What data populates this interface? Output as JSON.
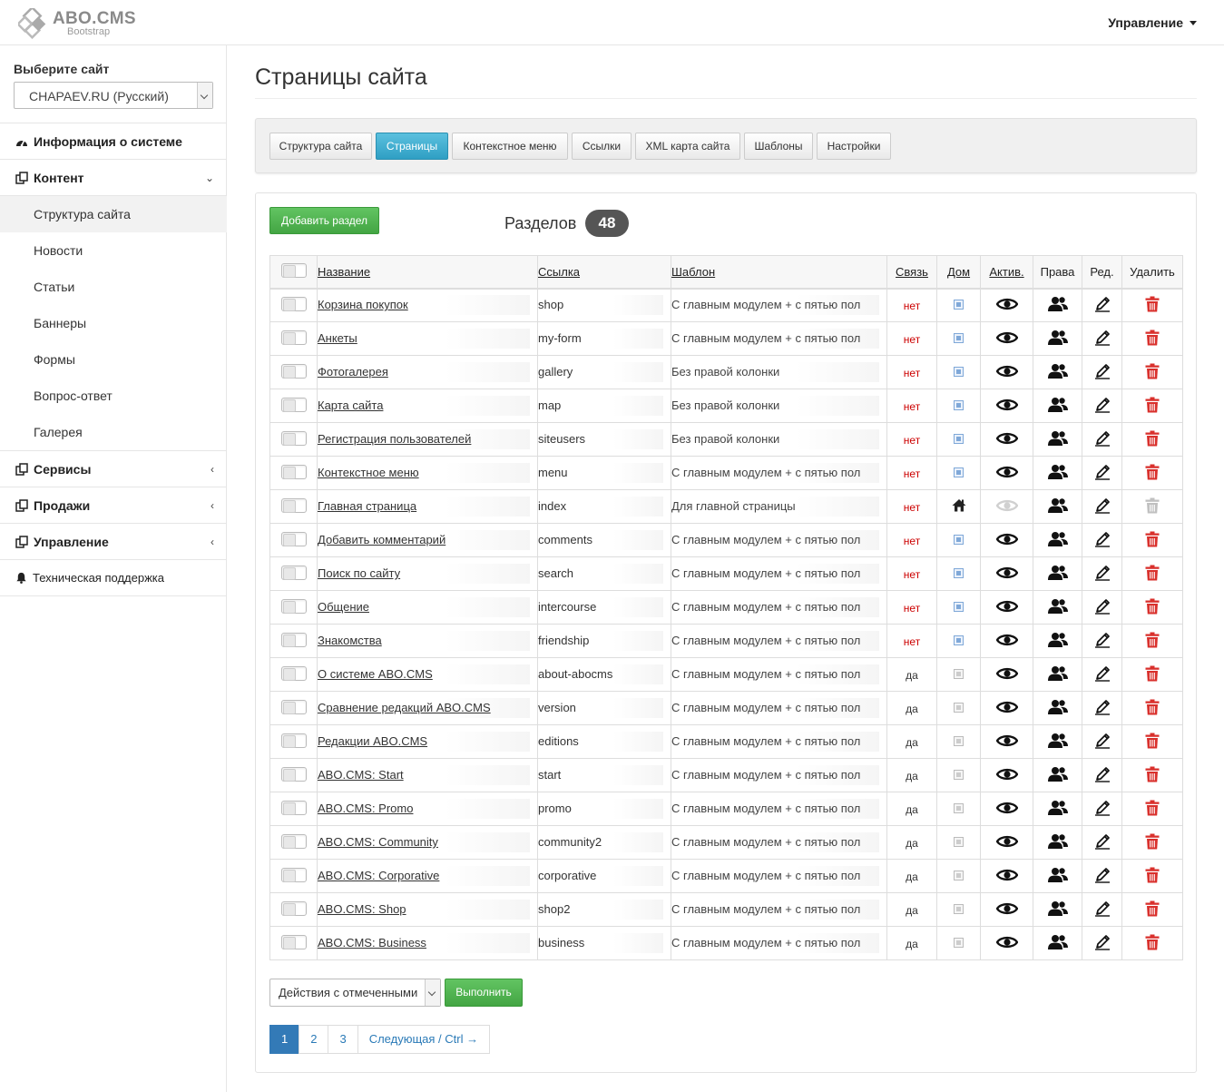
{
  "brand": {
    "title": "ABO.CMS",
    "subtitle": "Bootstrap"
  },
  "header": {
    "menu_label": "Управление"
  },
  "sidebar": {
    "site_label": "Выберите сайт",
    "site_value": "CHAPAEV.RU (Русский)",
    "info": "Информация о системе",
    "content": "Контент",
    "content_items": [
      "Структура сайта",
      "Новости",
      "Статьи",
      "Баннеры",
      "Формы",
      "Вопрос-ответ",
      "Галерея"
    ],
    "services": "Сервисы",
    "sales": "Продажи",
    "management": "Управление",
    "support": "Техническая поддержка"
  },
  "page": {
    "title": "Страницы сайта"
  },
  "tabs": [
    "Структура сайта",
    "Страницы",
    "Контекстное меню",
    "Ссылки",
    "XML карта сайта",
    "Шаблоны",
    "Настройки"
  ],
  "toolbar": {
    "add_label": "Добавить раздел",
    "count_label": "Разделов",
    "count": "48"
  },
  "table": {
    "headers": [
      "Название",
      "Ссылка",
      "Шаблон",
      "Связь",
      "Дом",
      "Актив.",
      "Права",
      "Ред.",
      "Удалить"
    ],
    "rows": [
      {
        "name": "Корзина покупок",
        "link": "shop",
        "tpl": "С главным модулем + с пятью пол",
        "rel": "нет"
      },
      {
        "name": "Анкеты",
        "link": "my-form",
        "tpl": "С главным модулем + с пятью пол",
        "rel": "нет"
      },
      {
        "name": "Фотогалерея",
        "link": "gallery",
        "tpl": "Без правой колонки",
        "rel": "нет"
      },
      {
        "name": "Карта сайта",
        "link": "map",
        "tpl": "Без правой колонки",
        "rel": "нет"
      },
      {
        "name": "Регистрация пользователей",
        "link": "siteusers",
        "tpl": "Без правой колонки",
        "rel": "нет"
      },
      {
        "name": "Контекстное меню",
        "link": "menu",
        "tpl": "С главным модулем + с пятью пол",
        "rel": "нет"
      },
      {
        "name": "Главная страница",
        "link": "index",
        "tpl": "Для главной страницы",
        "rel": "нет"
      },
      {
        "name": "Добавить комментарий",
        "link": "comments",
        "tpl": "С главным модулем + с пятью пол",
        "rel": "нет"
      },
      {
        "name": "Поиск по сайту",
        "link": "search",
        "tpl": "С главным модулем + с пятью пол",
        "rel": "нет"
      },
      {
        "name": "Общение",
        "link": "intercourse",
        "tpl": "С главным модулем + с пятью пол",
        "rel": "нет"
      },
      {
        "name": "Знакомства",
        "link": "friendship",
        "tpl": "С главным модулем + с пятью пол",
        "rel": "нет"
      },
      {
        "name": "О системе ABO.CMS",
        "link": "about-abocms",
        "tpl": "С главным модулем + с пятью пол",
        "rel": "да"
      },
      {
        "name": "Сравнение редакций ABO.CMS",
        "link": "version",
        "tpl": "С главным модулем + с пятью пол",
        "rel": "да"
      },
      {
        "name": "Редакции ABO.CMS",
        "link": "editions",
        "tpl": "С главным модулем + с пятью пол",
        "rel": "да"
      },
      {
        "name": "ABO.CMS: Start",
        "link": "start",
        "tpl": "С главным модулем + с пятью пол",
        "rel": "да"
      },
      {
        "name": "ABO.CMS: Promo",
        "link": "promo",
        "tpl": "С главным модулем + с пятью пол",
        "rel": "да"
      },
      {
        "name": "ABO.CMS: Community",
        "link": "community2",
        "tpl": "С главным модулем + с пятью пол",
        "rel": "да"
      },
      {
        "name": "ABO.CMS: Corporative",
        "link": "corporative",
        "tpl": "С главным модулем + с пятью пол",
        "rel": "да"
      },
      {
        "name": "ABO.CMS: Shop",
        "link": "shop2",
        "tpl": "С главным модулем + с пятью пол",
        "rel": "да"
      },
      {
        "name": "ABO.CMS: Business",
        "link": "business",
        "tpl": "С главным модулем + с пятью пол",
        "rel": "да"
      }
    ]
  },
  "footer": {
    "actions_value": "Действия с отмеченными",
    "run_label": "Выполнить",
    "pages": [
      "1",
      "2",
      "3"
    ],
    "next_label": "Следующая / Ctrl →"
  },
  "icons": {
    "eye": "eye-icon",
    "rights": "users-icon",
    "edit": "pencil-icon",
    "delete": "trash-icon",
    "home": "home-icon"
  },
  "colors": {
    "accent": "#2f9fc4",
    "green": "#43a543",
    "danger": "#d9302c",
    "link_no": "#cc0000"
  }
}
